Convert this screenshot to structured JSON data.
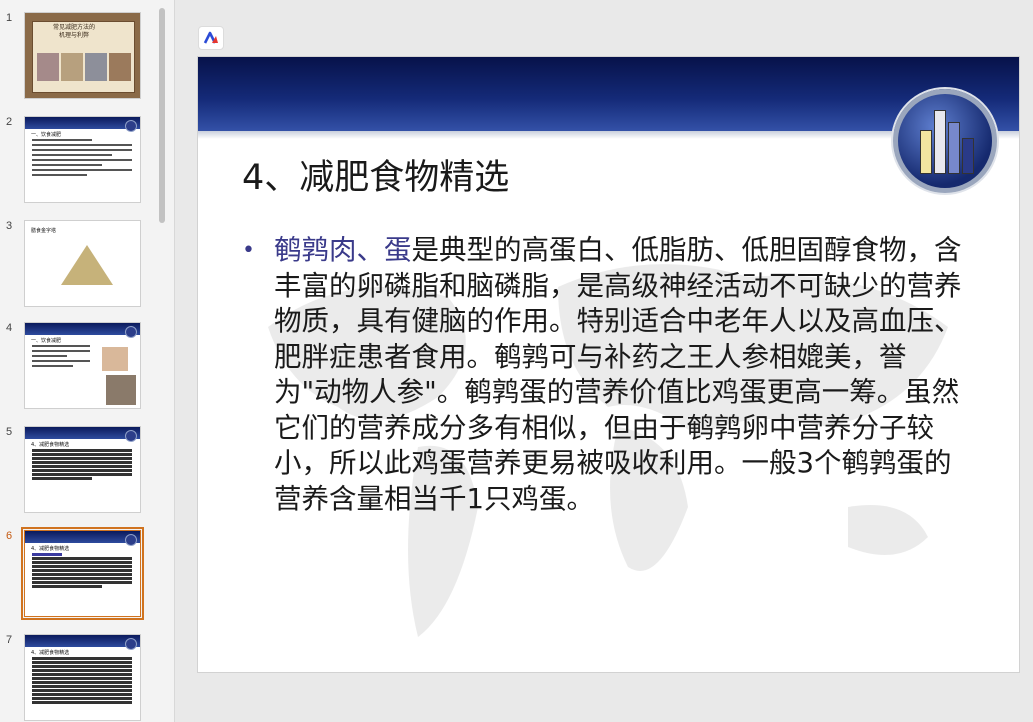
{
  "thumbnails": [
    {
      "num": "1",
      "kind": "cover",
      "title_line1": "常见减肥方法的",
      "title_line2": "机理与利弊"
    },
    {
      "num": "2",
      "kind": "text",
      "title": "一、饮食减肥"
    },
    {
      "num": "3",
      "kind": "pyramid",
      "title": "膳食金字塔"
    },
    {
      "num": "4",
      "kind": "text",
      "title": "一、饮食减肥"
    },
    {
      "num": "5",
      "kind": "text",
      "title": "4、减肥食物精选"
    },
    {
      "num": "6",
      "kind": "text",
      "title": "4、减肥食物精选",
      "active": true
    },
    {
      "num": "7",
      "kind": "text",
      "title": "4、减肥食物精选"
    }
  ],
  "slide": {
    "title": "4、减肥食物精选",
    "bullet_highlight": "鹌鹑肉、蛋",
    "bullet_rest": "是典型的高蛋白、低脂肪、低胆固醇食物，含丰富的卵磷脂和脑磷脂，是高级神经活动不可缺少的营养物质，具有健脑的作用。特别适合中老年人以及高血压、肥胖症患者食用。鹌鹑可与补药之王人参相媲美，誉为\"动物人参\"。鹌鹑蛋的营养价值比鸡蛋更高一筹。虽然它们的营养成分多有相似，但由于鹌鹑卵中营养分子较小，所以此鸡蛋营养更易被吸收利用。一般3个鹌鹑蛋的营养含量相当千1只鸡蛋。"
  },
  "colors": {
    "accent": "#d0731f",
    "band_dark": "#07124a",
    "highlight_text": "#3a3a8a"
  }
}
